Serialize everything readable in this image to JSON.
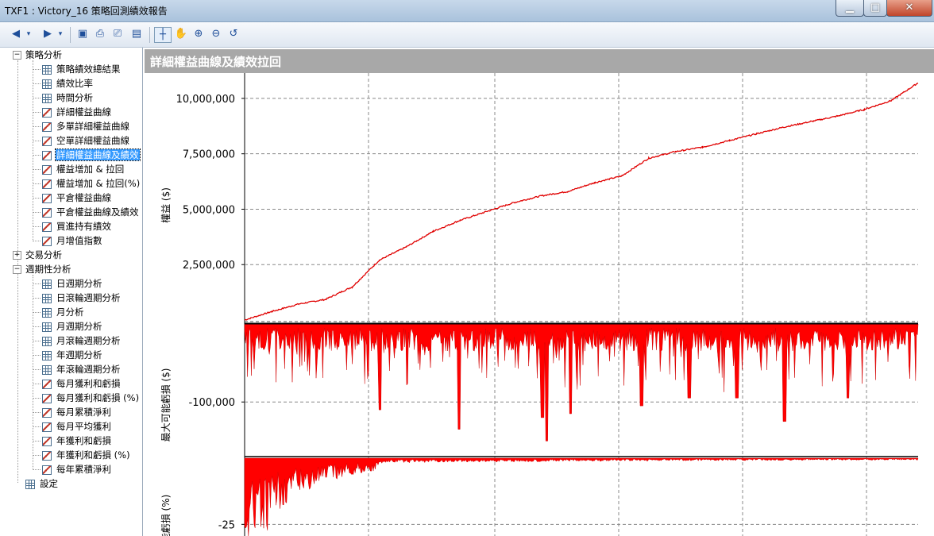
{
  "window": {
    "title": "TXF1 : Victory_16 策略回測績效報告"
  },
  "toolbar": {
    "icons": [
      "back-icon",
      "forward-icon",
      "save-icon",
      "print-preview-icon",
      "print-icon",
      "report-icon",
      "crosshair-icon",
      "hand-icon",
      "zoom-in-icon",
      "zoom-out-icon",
      "reset-zoom-icon"
    ]
  },
  "tree": [
    {
      "label": "策略分析",
      "level": 0,
      "expander": "−"
    },
    {
      "label": "策略績效總結果",
      "level": 1,
      "icon": "grid"
    },
    {
      "label": "績效比率",
      "level": 1,
      "icon": "grid"
    },
    {
      "label": "時間分析",
      "level": 1,
      "icon": "grid"
    },
    {
      "label": "詳細權益曲線",
      "level": 1,
      "icon": "chart"
    },
    {
      "label": "多單詳細權益曲線",
      "level": 1,
      "icon": "chart"
    },
    {
      "label": "空單詳細權益曲線",
      "level": 1,
      "icon": "chart"
    },
    {
      "label": "詳細權益曲線及績效",
      "level": 1,
      "icon": "chart",
      "selected": true
    },
    {
      "label": "權益增加 & 拉回",
      "level": 1,
      "icon": "chart"
    },
    {
      "label": "權益增加 & 拉回(%)",
      "level": 1,
      "icon": "chart"
    },
    {
      "label": "平倉權益曲線",
      "level": 1,
      "icon": "chart"
    },
    {
      "label": "平倉權益曲線及績效",
      "level": 1,
      "icon": "chart"
    },
    {
      "label": "買進持有績效",
      "level": 1,
      "icon": "chart"
    },
    {
      "label": "月增值指數",
      "level": 1,
      "icon": "chart"
    },
    {
      "label": "交易分析",
      "level": 0,
      "expander": "+"
    },
    {
      "label": "週期性分析",
      "level": 0,
      "expander": "−"
    },
    {
      "label": "日週期分析",
      "level": 1,
      "icon": "grid"
    },
    {
      "label": "日滾輪週期分析",
      "level": 1,
      "icon": "grid"
    },
    {
      "label": "月分析",
      "level": 1,
      "icon": "grid"
    },
    {
      "label": "月週期分析",
      "level": 1,
      "icon": "grid"
    },
    {
      "label": "月滾輪週期分析",
      "level": 1,
      "icon": "grid"
    },
    {
      "label": "年週期分析",
      "level": 1,
      "icon": "grid"
    },
    {
      "label": "年滾輪週期分析",
      "level": 1,
      "icon": "grid"
    },
    {
      "label": "每月獲利和虧損",
      "level": 1,
      "icon": "chart"
    },
    {
      "label": "每月獲利和虧損 (%)",
      "level": 1,
      "icon": "chart"
    },
    {
      "label": "每月累積淨利",
      "level": 1,
      "icon": "chart"
    },
    {
      "label": "每月平均獲利",
      "level": 1,
      "icon": "chart"
    },
    {
      "label": "年獲利和虧損",
      "level": 1,
      "icon": "chart"
    },
    {
      "label": "年獲利和虧損 (%)",
      "level": 1,
      "icon": "chart"
    },
    {
      "label": "每年累積淨利",
      "level": 1,
      "icon": "chart"
    },
    {
      "label": "設定",
      "level": 0,
      "icon": "grid"
    }
  ],
  "content": {
    "header": "詳細權益曲線及績效拉回"
  },
  "chart_data": [
    {
      "type": "line",
      "ylabel": "權益 ($)",
      "yticks": [
        2500000,
        5000000,
        7500000,
        10000000
      ],
      "ytick_labels": [
        "2,500,000",
        "5,000,000",
        "7,500,000",
        "10,000,000"
      ],
      "ylim": [
        0,
        11000000
      ],
      "series": [
        {
          "x": [
            0,
            0.04,
            0.08,
            0.12,
            0.16,
            0.2,
            0.24,
            0.28,
            0.32,
            0.36,
            0.4,
            0.44,
            0.48,
            0.52,
            0.56,
            0.6,
            0.64,
            0.68,
            0.72,
            0.76,
            0.8,
            0.84,
            0.88,
            0.92,
            0.96,
            1.0
          ],
          "values": [
            0,
            380000,
            720000,
            930000,
            1500000,
            2700000,
            3300000,
            4000000,
            4500000,
            4900000,
            5300000,
            5600000,
            5800000,
            6200000,
            6500000,
            7300000,
            7600000,
            7800000,
            8100000,
            8400000,
            8700000,
            8950000,
            9200000,
            9500000,
            9900000,
            10700000
          ]
        }
      ],
      "color": "#e00000",
      "grid": true
    },
    {
      "type": "area",
      "ylabel": "最大可能虧損 ($)",
      "yticks": [
        -100000
      ],
      "ytick_labels": [
        "-100,000"
      ],
      "ylim": [
        -170000,
        0
      ],
      "color": "#ff0000",
      "grid": true
    },
    {
      "type": "area",
      "ylabel": "能虧損 (%)",
      "yticks": [
        -25
      ],
      "ytick_labels": [
        "-25"
      ],
      "ylim": [
        -30,
        0
      ],
      "color": "#ff0000",
      "grid": true
    }
  ]
}
